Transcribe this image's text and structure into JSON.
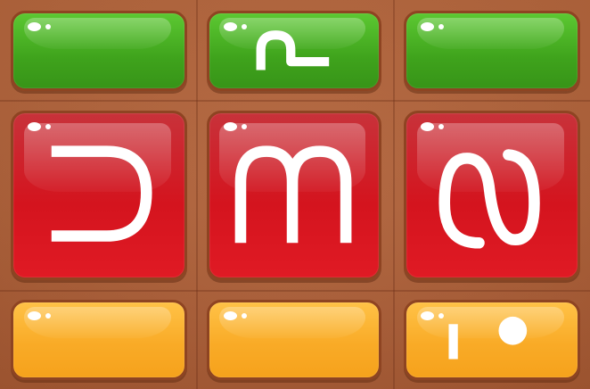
{
  "board": {
    "colors": {
      "wood": "#b0623a",
      "tile_border": "#8e4422",
      "green": "#43aa1f",
      "red": "#d4141e",
      "orange": "#f9ab27",
      "glyph": "#ffffff"
    },
    "tiles": [
      {
        "row": 0,
        "col": 0,
        "color": "green",
        "glyph_icon": "blank"
      },
      {
        "row": 0,
        "col": 1,
        "color": "green",
        "glyph_icon": "hook-glyph-icon"
      },
      {
        "row": 0,
        "col": 2,
        "color": "green",
        "glyph_icon": "blank"
      },
      {
        "row": 1,
        "col": 0,
        "color": "red",
        "glyph_icon": "reversed-c-glyph-icon"
      },
      {
        "row": 1,
        "col": 1,
        "color": "red",
        "glyph_icon": "m-glyph-icon"
      },
      {
        "row": 1,
        "col": 2,
        "color": "red",
        "glyph_icon": "loop-glyph-icon"
      },
      {
        "row": 2,
        "col": 0,
        "color": "orange",
        "glyph_icon": "blank"
      },
      {
        "row": 2,
        "col": 1,
        "color": "orange",
        "glyph_icon": "blank"
      },
      {
        "row": 2,
        "col": 2,
        "color": "orange",
        "glyph_icon": "bar-dot-glyph-icon"
      }
    ]
  }
}
